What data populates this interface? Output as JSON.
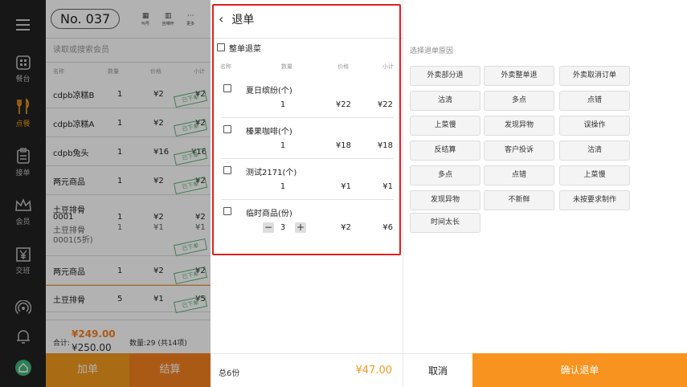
{
  "colors": {
    "accent": "#f39a1c",
    "confirm": "#f7931e",
    "highlight": "#e02020"
  },
  "nav": {
    "items": [
      {
        "label": "餐台",
        "icon": "table-icon"
      },
      {
        "label": "点餐",
        "icon": "fork-knife-icon"
      },
      {
        "label": "接单",
        "icon": "clipboard-icon"
      },
      {
        "label": "会员",
        "icon": "crown-icon"
      },
      {
        "label": "交班",
        "icon": "yen-icon"
      }
    ]
  },
  "order": {
    "number": "No. 037",
    "top_buttons": [
      {
        "label": "叫号",
        "icon": "call-number-icon"
      },
      {
        "label": "自带杯",
        "icon": "cup-icon"
      },
      {
        "label": "更多",
        "icon": "more-icon"
      }
    ],
    "member_placeholder": "读取或搜索会员",
    "columns": [
      "名称",
      "数量",
      "价格",
      "小计"
    ],
    "rows": [
      {
        "name": "cdpb凉糕B",
        "qty": "1",
        "price": "¥2",
        "subtotal": "¥2",
        "stamp": "已下单"
      },
      {
        "name": "cdpb凉糕A",
        "qty": "1",
        "price": "¥2",
        "subtotal": "¥2",
        "stamp": "已下单"
      },
      {
        "name": "cdpb兔头",
        "qty": "1",
        "price": "¥16",
        "subtotal": "¥16",
        "stamp": "已下单"
      },
      {
        "name": "两元商品",
        "qty": "1",
        "price": "¥2",
        "subtotal": "¥2",
        "stamp": "已下单"
      },
      {
        "name": "土豆排骨",
        "code": "0001",
        "qty": "1",
        "price": "¥2",
        "subtotal": "¥2",
        "sub_name": "土豆排骨",
        "sub_code": "0001(5折)",
        "sub_qty": "1",
        "sub_price": "¥1",
        "sub_subtotal": "¥1",
        "stamp": "已下单"
      },
      {
        "name": "两元商品",
        "qty": "1",
        "price": "¥2",
        "subtotal": "¥2",
        "stamp": "已下单"
      },
      {
        "name": "土豆排骨",
        "qty": "5",
        "price": "¥1",
        "subtotal": "¥5",
        "stamp": "已下单"
      }
    ],
    "total_label": "合计:",
    "total_amount": "¥249.00",
    "total_original": "¥250.00",
    "count_text": "数量:29 (共14项)",
    "add_label": "加单",
    "pay_label": "结算"
  },
  "refund": {
    "title": "退单",
    "whole_label": "整单退菜",
    "columns": [
      "名称",
      "数量",
      "价格",
      "小计"
    ],
    "items": [
      {
        "name": "夏日缤纷(个)",
        "qty": "1",
        "price": "¥22",
        "subtotal": "¥22"
      },
      {
        "name": "榛果咖啡(个)",
        "qty": "1",
        "price": "¥18",
        "subtotal": "¥18"
      },
      {
        "name": "测试2171(个)",
        "qty": "1",
        "price": "¥1",
        "subtotal": "¥1"
      },
      {
        "name": "临时商品(份)",
        "qty": "3",
        "price": "¥2",
        "subtotal": "¥6",
        "stepper": true
      }
    ],
    "total_count": "总6份",
    "total_amount": "¥47.00"
  },
  "reasons": {
    "label": "选择退单原因",
    "options": [
      "外卖部分退",
      "外卖整单退",
      "外卖取消订单",
      "沽清",
      "多点",
      "点错",
      "上菜慢",
      "发现异物",
      "误操作",
      "反结算",
      "客户投诉",
      "沽清",
      "多点",
      "点错",
      "上菜慢",
      "发现异物",
      "不新鲜",
      "未按要求制作",
      "时间太长"
    ],
    "cancel_label": "取消",
    "confirm_label": "确认退单"
  }
}
